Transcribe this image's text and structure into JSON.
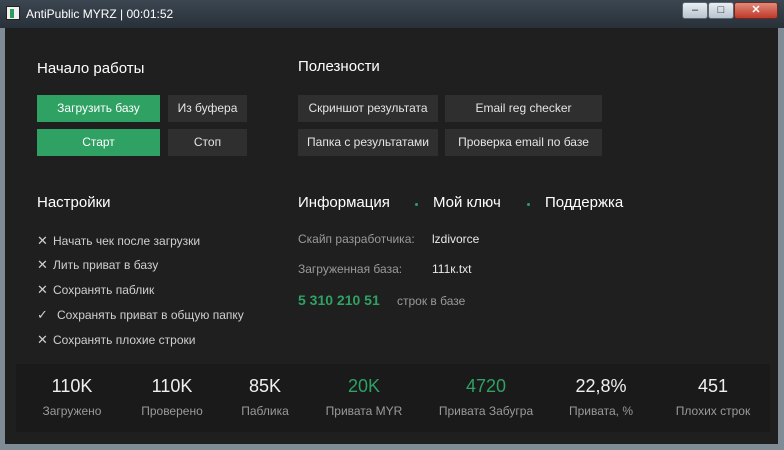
{
  "window": {
    "title": "AntiPublic MYRZ | 00:01:52",
    "minimize": "–",
    "maximize": "□",
    "close": "✕"
  },
  "colors": {
    "accent": "#2ea163",
    "background": "#1f1f1f",
    "button": "#2f2f2f"
  },
  "start": {
    "title": "Начало работы",
    "load_db": "Загрузить базу",
    "from_clipboard": "Из буфера",
    "start": "Старт",
    "stop": "Стоп"
  },
  "utilities": {
    "title": "Полезности",
    "screenshot": "Скриншот результата",
    "email_reg": "Email reg checker",
    "results_folder": "Папка с результатами",
    "email_check": "Проверка email по базе"
  },
  "settings": {
    "title": "Настройки",
    "items": [
      {
        "label": "Начать чек после загрузки",
        "mark": "✕"
      },
      {
        "label": "Лить приват в базу",
        "mark": "✕"
      },
      {
        "label": "Сохранять паблик",
        "mark": "✕"
      },
      {
        "label": "Сохранять приват в общую папку",
        "mark": "✓"
      },
      {
        "label": "Сохранять плохие строки",
        "mark": "✕"
      }
    ]
  },
  "info": {
    "tab_info": "Информация",
    "tab_key": "Мой ключ",
    "tab_support": "Поддержка",
    "skype_label": "Скайп разработчика:",
    "skype_value": "lzdivorce",
    "db_label": "Загруженная база:",
    "db_value": "111к.txt",
    "rows_count": "5 310 210 51",
    "rows_label": "строк в базе"
  },
  "stats": [
    {
      "value": "110K",
      "label": "Загружено"
    },
    {
      "value": "110K",
      "label": "Проверено"
    },
    {
      "value": "85K",
      "label": "Паблика"
    },
    {
      "value": "20K",
      "label": "Привата MYR"
    },
    {
      "value": "4720",
      "label": "Привата Забугра"
    },
    {
      "value": "22,8%",
      "label": "Привата, %"
    },
    {
      "value": "451",
      "label": "Плохих строк"
    }
  ]
}
